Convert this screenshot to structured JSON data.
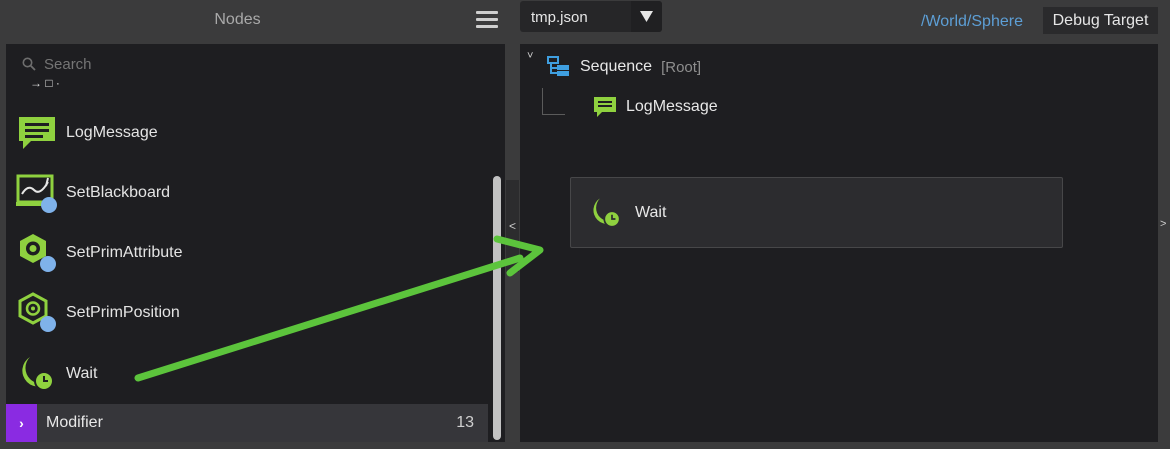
{
  "left_panel": {
    "title": "Nodes",
    "search_placeholder": "Search",
    "partial_row_text": "→ □   ·",
    "nodes": [
      {
        "label": "LogMessage",
        "icon": "message-icon"
      },
      {
        "label": "SetBlackboard",
        "icon": "blackboard-chart-icon"
      },
      {
        "label": "SetPrimAttribute",
        "icon": "prim-attribute-gear-icon"
      },
      {
        "label": "SetPrimPosition",
        "icon": "prim-position-target-icon"
      },
      {
        "label": "Wait",
        "icon": "wait-moon-clock-icon"
      }
    ],
    "category": {
      "label": "Modifier",
      "count": "13",
      "chevron": "›",
      "color": "#8a2be2"
    }
  },
  "splitter": {
    "left_caret": "<",
    "right_caret": ">"
  },
  "toolbar": {
    "file_name": "tmp.json",
    "prim_path": "/World/Sphere",
    "debug_target_label": "Debug Target"
  },
  "tree": {
    "collapse_caret": "˅",
    "root": {
      "name": "Sequence",
      "tag": "[Root]",
      "icon": "sequence-icon"
    },
    "children": [
      {
        "name": "LogMessage",
        "icon": "message-icon"
      }
    ]
  },
  "drop_target": {
    "label": "Wait",
    "icon": "wait-moon-clock-icon"
  },
  "colors": {
    "accent_green": "#8fd13f",
    "arrow_green": "#5cc43c",
    "sequence_blue": "#3f9fe0",
    "link_blue": "#5d9fd6",
    "category_purple": "#8a2be2",
    "panel_bg": "#1e1e21",
    "chrome_bg": "#3b3b3c"
  }
}
